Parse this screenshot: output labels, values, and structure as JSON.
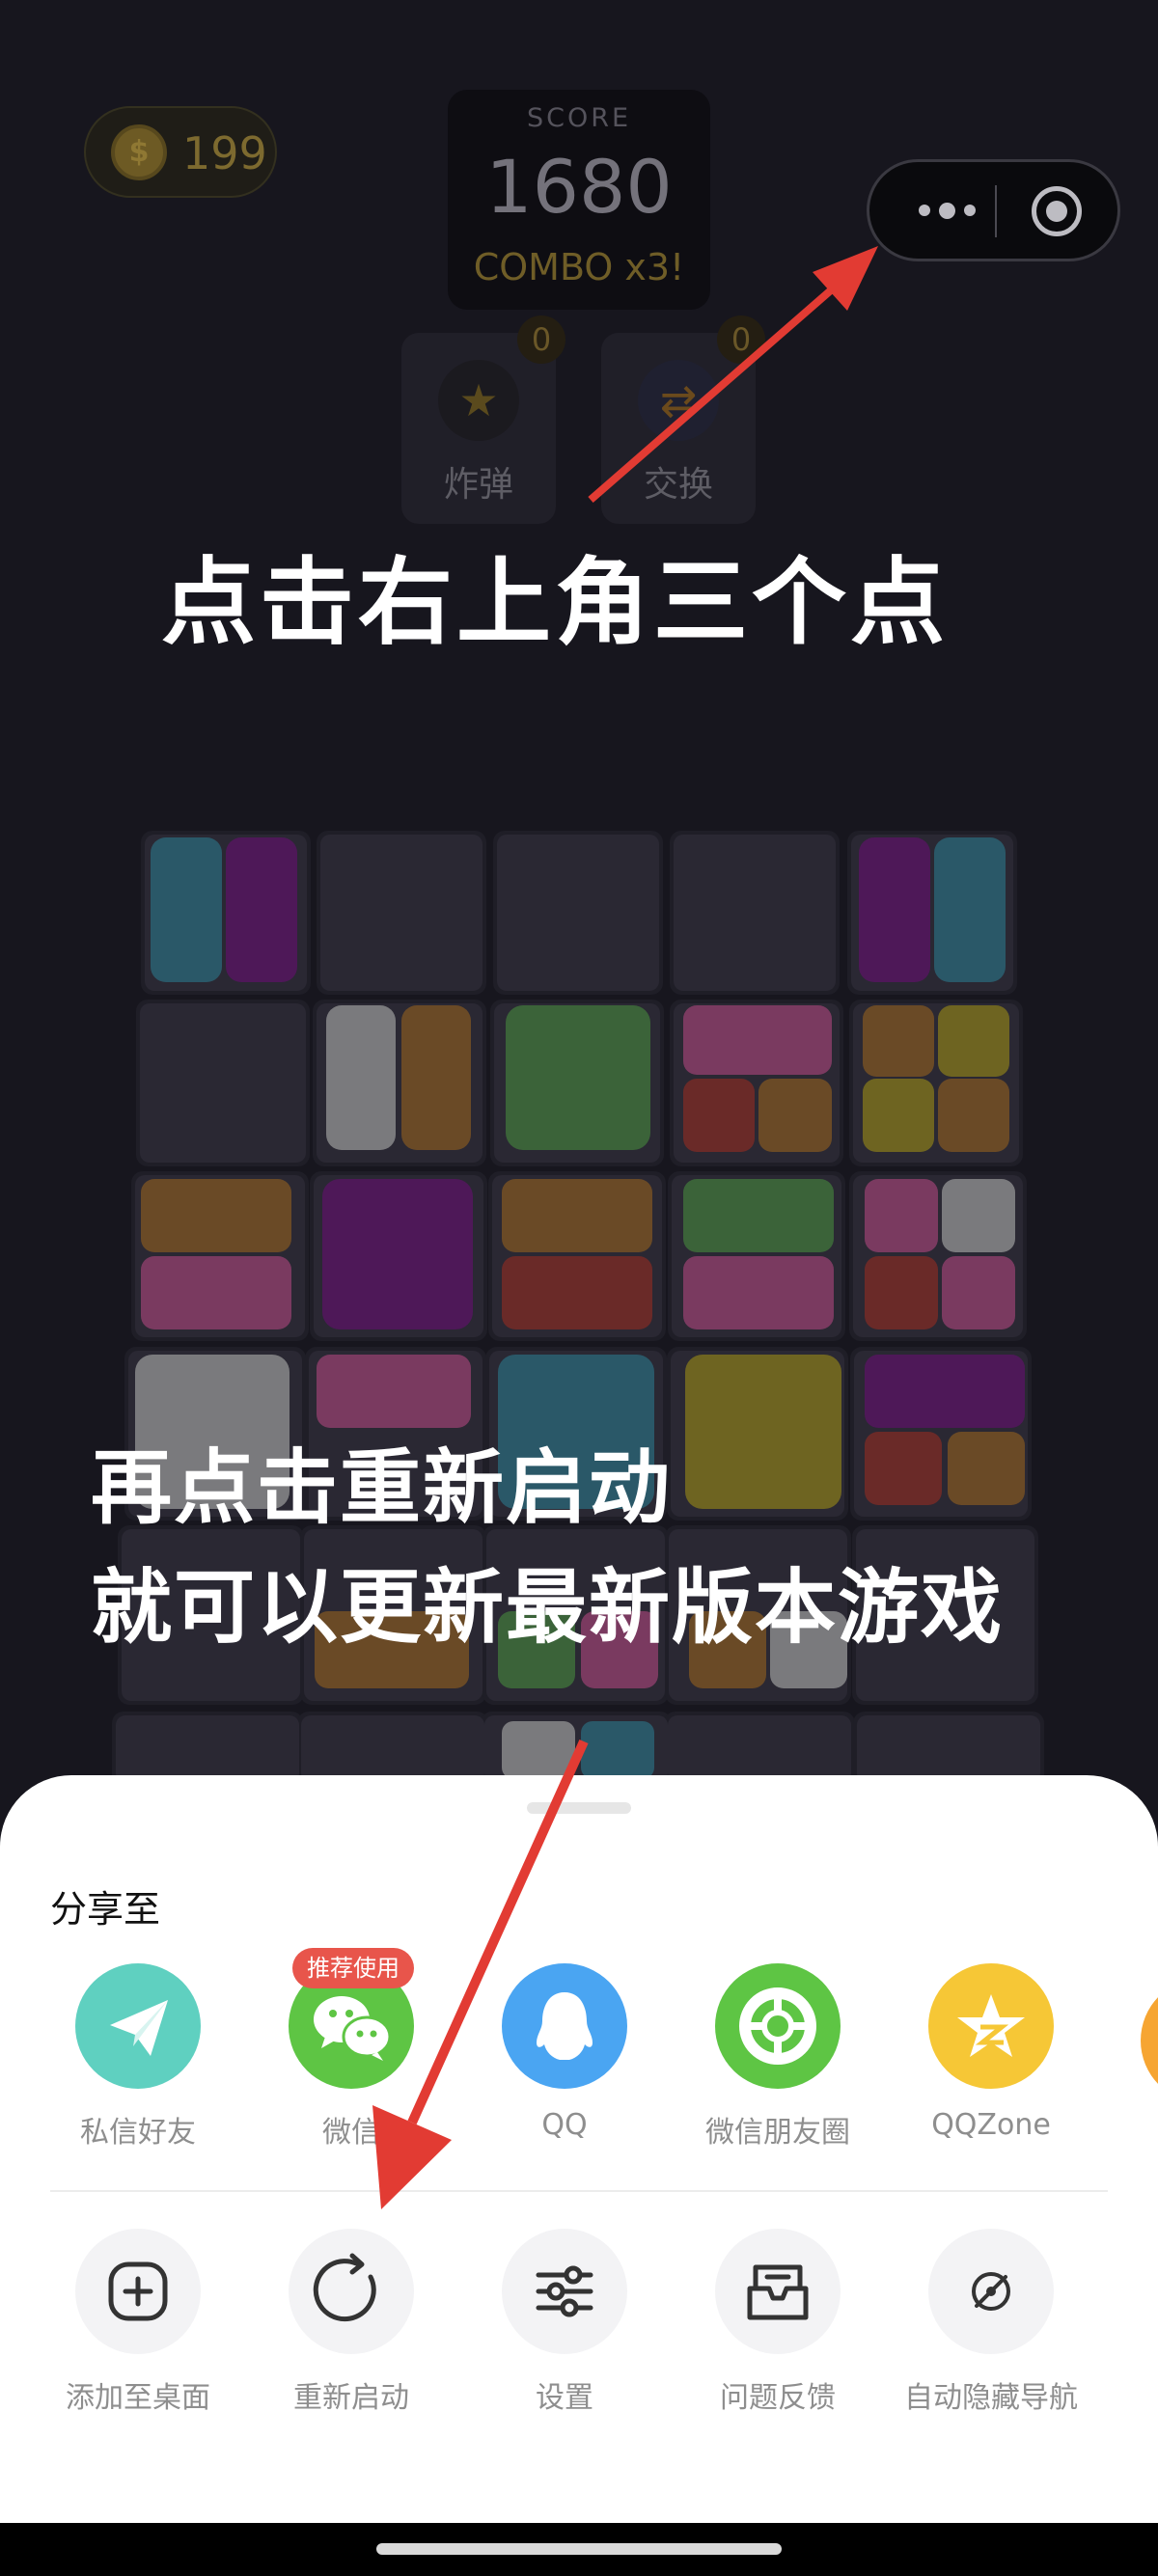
{
  "hud": {
    "coins": "199",
    "coin_symbol": "$",
    "score_label": "SCORE",
    "score": "1680",
    "combo": "COMBO x3!"
  },
  "tools": [
    {
      "label": "炸弹",
      "count": "0",
      "icon": "bomb-icon"
    },
    {
      "label": "交换",
      "count": "0",
      "icon": "swap-icon"
    }
  ],
  "capsule": {
    "more_icon": "more-dots-icon",
    "close_icon": "close-target-icon"
  },
  "instructions": {
    "line1": "点击右上角三个点",
    "line2": "再点击重新启动",
    "line3": "就可以更新最新版本游戏"
  },
  "share_sheet": {
    "title": "分享至",
    "recommend_badge": "推荐使用",
    "share_targets": [
      {
        "label": "私信好友",
        "icon": "paper-plane-icon",
        "color": "#5fd0c0"
      },
      {
        "label": "微信",
        "icon": "wechat-icon",
        "color": "#5ec544"
      },
      {
        "label": "QQ",
        "icon": "qq-penguin-icon",
        "color": "#4aa5f2"
      },
      {
        "label": "微信朋友圈",
        "icon": "moments-aperture-icon",
        "color": "#5ec544"
      },
      {
        "label": "QQZone",
        "icon": "qzone-star-icon",
        "color": "#f6c736"
      }
    ],
    "actions": [
      {
        "label": "添加至桌面",
        "icon": "add-to-desktop-icon"
      },
      {
        "label": "重新启动",
        "icon": "restart-icon"
      },
      {
        "label": "设置",
        "icon": "settings-sliders-icon"
      },
      {
        "label": "问题反馈",
        "icon": "feedback-inbox-icon"
      },
      {
        "label": "自动隐藏导航",
        "icon": "hide-navigation-icon"
      }
    ]
  },
  "colors": {
    "arrow": "#e23b33",
    "tile_cyan": "#2a5868",
    "tile_purple": "#4e1858",
    "tile_grey": "#7a7a7d",
    "tile_brown": "#6a4a26",
    "tile_green": "#3b6339",
    "tile_pink": "#7a3a60",
    "tile_red": "#6a2a28",
    "tile_yellow": "#6e6421"
  }
}
